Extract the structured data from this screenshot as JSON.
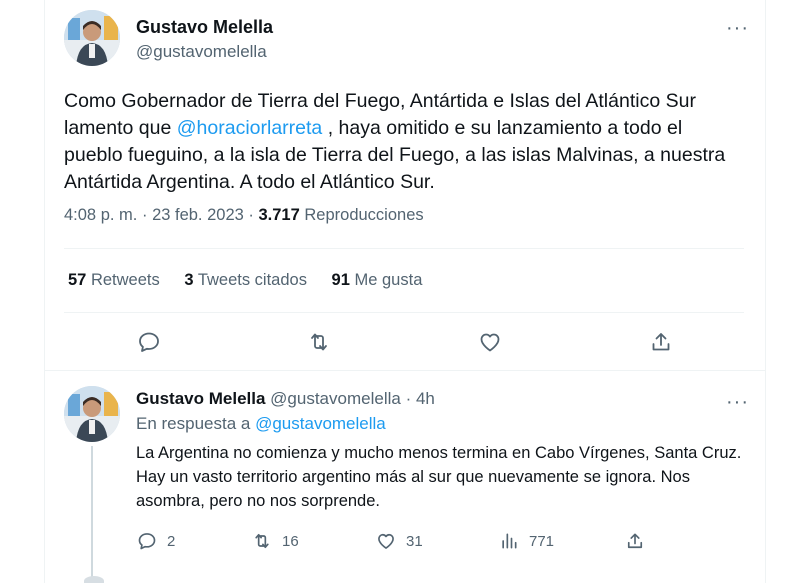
{
  "main_tweet": {
    "author_name": "Gustavo Melella",
    "handle": "@gustavomelella",
    "text_before": "Como Gobernador de Tierra del Fuego, Antártida e Islas del Atlántico Sur lamento que ",
    "mention": "@horaciorlarreta",
    "text_after": " , haya omitido e su lanzamiento a todo el pueblo fueguino, a la isla de Tierra del Fuego, a las islas Malvinas, a nuestra Antártida Argentina.  A todo el Atlántico Sur.",
    "time": "4:08 p. m.",
    "date": "23 feb. 2023",
    "views": "3.717",
    "views_label": "Reproducciones",
    "separator": "·",
    "retweets": "57",
    "retweets_label": "Retweets",
    "quotes": "3",
    "quotes_label": "Tweets citados",
    "likes": "91",
    "likes_label": "Me gusta",
    "more": "···"
  },
  "reply_tweet": {
    "author_name": "Gustavo Melella",
    "handle": "@gustavomelella",
    "age": "4h",
    "replying_prefix": "En respuesta a",
    "replying_to": "@gustavomelella",
    "text": "La Argentina no comienza y mucho menos termina en Cabo Vírgenes, Santa Cruz. Hay un vasto territorio argentino más al sur que nuevamente se ignora. Nos asombra, pero no nos sorprende.",
    "replies": "2",
    "retweets": "16",
    "likes": "31",
    "views": "771",
    "more": "···"
  },
  "colors": {
    "accent": "#1d9bf0",
    "secondary_text": "#536471",
    "primary_text": "#0f1419"
  },
  "icons": [
    "reply-icon",
    "retweet-icon",
    "like-icon",
    "share-icon",
    "views-icon",
    "more-icon"
  ]
}
